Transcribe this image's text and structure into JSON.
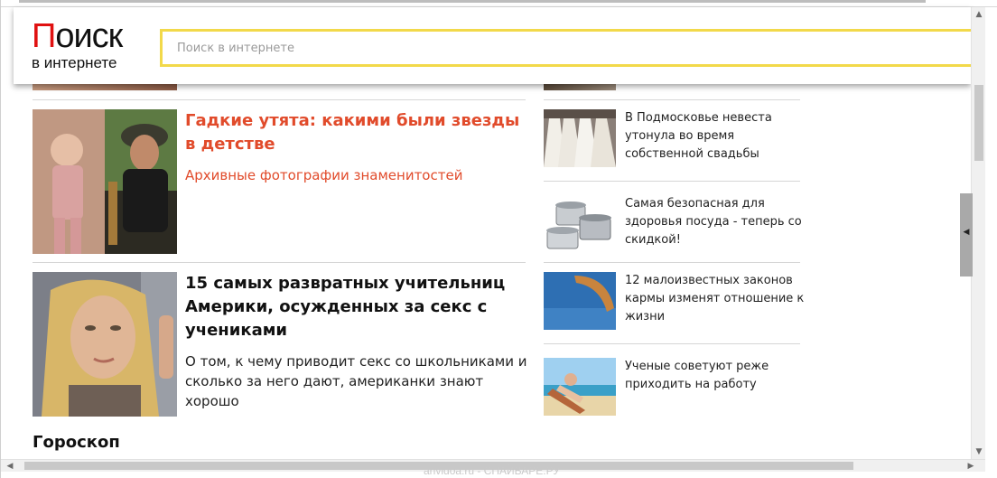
{
  "header": {
    "logo_main_red": "П",
    "logo_main_rest": "оиск",
    "logo_sub": "в интернете",
    "search_placeholder": "Поиск в интернете"
  },
  "main_articles": [
    {
      "title": "Гадкие утята: какими были звезды в детстве",
      "subtitle": "Архивные фотографии знаменитостей",
      "title_color": "#e14b2b"
    },
    {
      "title": "15 самых развратных учительниц Америки, осужденных за секс с учениками",
      "subtitle": "О том, к чему приводит секс со школьниками и сколько за него дают, американки знают хорошо",
      "title_color": "#111111"
    }
  ],
  "side_articles": [
    {
      "text": "В Подмосковье невеста утонула во время собственной свадьбы"
    },
    {
      "text": "Самая безопасная для здоровья посуда - теперь со скидкой!"
    },
    {
      "text": "12 малоизвестных законов кармы изменят отношение к жизни"
    },
    {
      "text": "Ученые советуют реже приходить на работу"
    }
  ],
  "section": {
    "title": "Гороскоп"
  },
  "watermark": "anvidoa.ru - СПАЙВАРЕ.РУ",
  "colors": {
    "search_border": "#f2d94a",
    "logo_red": "#e01010",
    "accent_title": "#e14b2b"
  }
}
